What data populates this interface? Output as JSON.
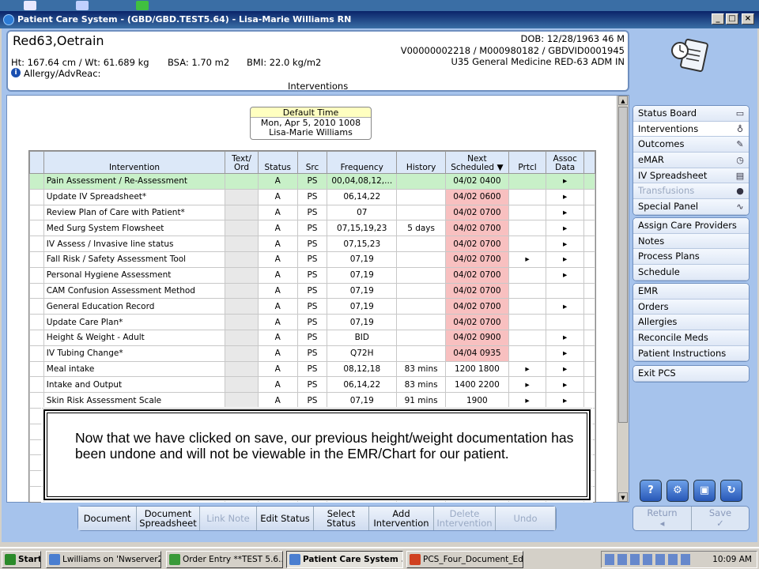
{
  "window": {
    "title": "Patient Care System - (GBD/GBD.TEST5.64) - Lisa-Marie Williams RN"
  },
  "patient": {
    "name": "Red63,Oetrain",
    "dob": "DOB: 12/28/1963 46 M",
    "ids": "V00000002218 / M000980182 / GBDVID0001945",
    "location": "U35 General Medicine  RED-63  ADM IN",
    "vitals": "Ht: 167.64 cm / Wt: 61.689 kg",
    "bsa": "BSA: 1.70 m2",
    "bmi": "BMI: 22.0 kg/m2",
    "allergy": "Allergy/AdvReac:",
    "screen_title": "Interventions"
  },
  "default_time": {
    "label": "Default Time",
    "datetime": "Mon, Apr 5, 2010  1008",
    "user": "Lisa-Marie Williams"
  },
  "table": {
    "headers": {
      "intervention": "Intervention",
      "text_ord": "Text/ Ord",
      "status": "Status",
      "src": "Src",
      "frequency": "Frequency",
      "history": "History",
      "next_scheduled": "Next Scheduled",
      "prtcl": "Prtcl",
      "assoc_data": "Assoc Data"
    },
    "rows": [
      {
        "name": "Pain Assessment / Re-Assessment",
        "status": "A",
        "src": "PS",
        "freq": "00,04,08,12,...",
        "hist": "",
        "next": "04/02 0400",
        "prtcl": "",
        "assoc": "▸"
      },
      {
        "name": "Update IV Spreadsheet*",
        "status": "A",
        "src": "PS",
        "freq": "06,14,22",
        "hist": "",
        "next": "04/02 0600",
        "prtcl": "",
        "assoc": "▸"
      },
      {
        "name": "Review Plan of Care with Patient*",
        "status": "A",
        "src": "PS",
        "freq": "07",
        "hist": "",
        "next": "04/02 0700",
        "prtcl": "",
        "assoc": "▸"
      },
      {
        "name": "Med Surg System Flowsheet",
        "status": "A",
        "src": "PS",
        "freq": "07,15,19,23",
        "hist": "5 days",
        "next": "04/02 0700",
        "prtcl": "",
        "assoc": "▸"
      },
      {
        "name": "IV Assess / Invasive line status",
        "status": "A",
        "src": "PS",
        "freq": "07,15,23",
        "hist": "",
        "next": "04/02 0700",
        "prtcl": "",
        "assoc": "▸"
      },
      {
        "name": "Fall Risk / Safety Assessment Tool",
        "status": "A",
        "src": "PS",
        "freq": "07,19",
        "hist": "",
        "next": "04/02 0700",
        "prtcl": "▸",
        "assoc": "▸"
      },
      {
        "name": "Personal Hygiene Assessment",
        "status": "A",
        "src": "PS",
        "freq": "07,19",
        "hist": "",
        "next": "04/02 0700",
        "prtcl": "",
        "assoc": "▸"
      },
      {
        "name": "CAM Confusion Assessment Method",
        "status": "A",
        "src": "PS",
        "freq": "07,19",
        "hist": "",
        "next": "04/02 0700",
        "prtcl": "",
        "assoc": ""
      },
      {
        "name": "General Education Record",
        "status": "A",
        "src": "PS",
        "freq": "07,19",
        "hist": "",
        "next": "04/02 0700",
        "prtcl": "",
        "assoc": "▸"
      },
      {
        "name": "Update Care Plan*",
        "status": "A",
        "src": "PS",
        "freq": "07,19",
        "hist": "",
        "next": "04/02 0700",
        "prtcl": "",
        "assoc": ""
      },
      {
        "name": "Height & Weight - Adult",
        "status": "A",
        "src": "PS",
        "freq": "BID",
        "hist": "",
        "next": "04/02 0900",
        "prtcl": "",
        "assoc": "▸"
      },
      {
        "name": "IV Tubing Change*",
        "status": "A",
        "src": "PS",
        "freq": "Q72H",
        "hist": "",
        "next": "04/04 0935",
        "prtcl": "",
        "assoc": "▸"
      },
      {
        "name": "Meal intake",
        "status": "A",
        "src": "PS",
        "freq": "08,12,18",
        "hist": "83 mins",
        "next": "1200 1800",
        "prtcl": "▸",
        "assoc": "▸"
      },
      {
        "name": "Intake and Output",
        "status": "A",
        "src": "PS",
        "freq": "06,14,22",
        "hist": "83 mins",
        "next": "1400 2200",
        "prtcl": "▸",
        "assoc": "▸"
      },
      {
        "name": "Skin Risk Assessment Scale",
        "status": "A",
        "src": "PS",
        "freq": "07,19",
        "hist": "91 mins",
        "next": "1900",
        "prtcl": "▸",
        "assoc": "▸"
      }
    ]
  },
  "side_nav": {
    "group1": [
      {
        "label": "Status Board",
        "icon": "folder-icon"
      },
      {
        "label": "Interventions",
        "icon": "stethoscope-icon"
      },
      {
        "label": "Outcomes",
        "icon": "check-pencil-icon"
      },
      {
        "label": "eMAR",
        "icon": "clock-icon"
      },
      {
        "label": "IV Spreadsheet",
        "icon": "spreadsheet-icon"
      },
      {
        "label": "Transfusions",
        "icon": "blood-drop-icon"
      },
      {
        "label": "Special Panel",
        "icon": "heartbeat-icon"
      }
    ],
    "group2": [
      "Assign Care Providers",
      "Notes",
      "Process Plans",
      "Schedule"
    ],
    "group3": [
      "EMR",
      "Orders",
      "Allergies",
      "Reconcile Meds",
      "Patient Instructions"
    ],
    "group4": [
      "Exit PCS"
    ]
  },
  "bottom_buttons": [
    {
      "label": "Document",
      "enabled": true
    },
    {
      "label": "Document Spreadsheet",
      "enabled": true
    },
    {
      "label": "Link Note",
      "enabled": false
    },
    {
      "label": "Edit Status",
      "enabled": true
    },
    {
      "label": "Select Status",
      "enabled": true
    },
    {
      "label": "Add Intervention",
      "enabled": true
    },
    {
      "label": "Delete Intervention",
      "enabled": false
    },
    {
      "label": "Undo",
      "enabled": false
    }
  ],
  "return_label": "Return",
  "save_label": "Save",
  "note_text": "Now that we have clicked on save, our previous height/weight documentation has been undone and will not be viewable in the EMR/Chart for our patient.",
  "taskbar": {
    "start": "Start",
    "items": [
      "Lwilliams on 'Nwserver2\\...",
      "Order Entry **TEST 5.6...",
      "Patient Care System ...",
      "PCS_Four_Document_Ed..."
    ],
    "clock": "10:09 AM"
  },
  "colors": {
    "title_bar": "#0a246a",
    "panel_bg": "#a6c3ec",
    "selected_row": "#c8f0c8",
    "overdue": "#f8c0c0"
  }
}
